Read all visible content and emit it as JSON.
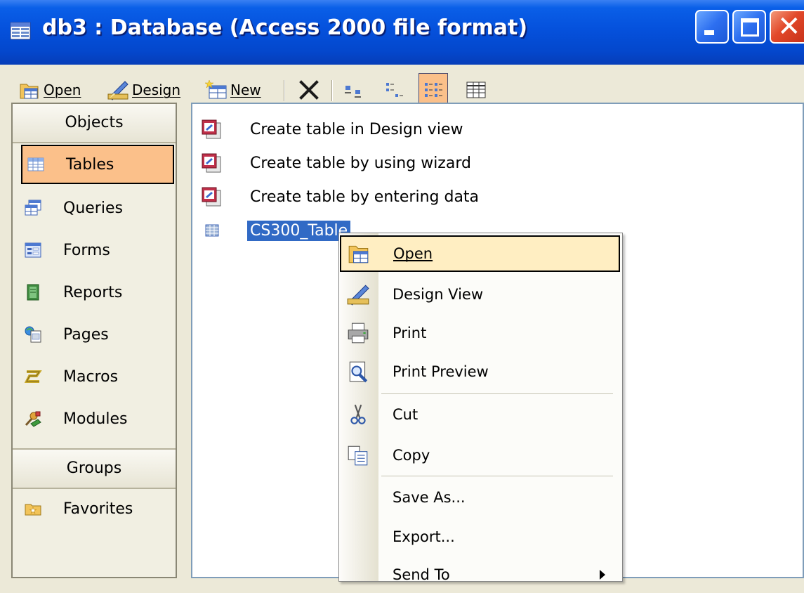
{
  "window": {
    "title": "db3 : Database (Access 2000 file format)"
  },
  "toolbar": {
    "open_label": "Open",
    "design_label": "Design",
    "new_label": "New"
  },
  "objects": {
    "header": "Objects",
    "items": [
      {
        "label": "Tables",
        "icon": "table-icon"
      },
      {
        "label": "Queries",
        "icon": "query-icon"
      },
      {
        "label": "Forms",
        "icon": "form-icon"
      },
      {
        "label": "Reports",
        "icon": "report-icon"
      },
      {
        "label": "Pages",
        "icon": "page-icon"
      },
      {
        "label": "Macros",
        "icon": "macro-icon"
      },
      {
        "label": "Modules",
        "icon": "module-icon"
      }
    ],
    "selected": "Tables"
  },
  "groups": {
    "header": "Groups",
    "items": [
      {
        "label": "Favorites",
        "icon": "favorites-folder-icon"
      }
    ]
  },
  "list": {
    "items": [
      {
        "label": "Create table in Design view"
      },
      {
        "label": "Create table by using wizard"
      },
      {
        "label": "Create table by entering data"
      },
      {
        "label": "CS300_Table"
      }
    ],
    "selected": "CS300_Table"
  },
  "context_menu": {
    "items": [
      {
        "label": "Open"
      },
      {
        "label": "Design View"
      },
      {
        "label": "Print"
      },
      {
        "label": "Print Preview"
      },
      {
        "label": "Cut"
      },
      {
        "label": "Copy"
      },
      {
        "label": "Save As..."
      },
      {
        "label": "Export..."
      },
      {
        "label": "Send To"
      }
    ],
    "highlighted": "Open"
  },
  "colors": {
    "titlebar": "#0551dc",
    "selected_object": "#fbc08a",
    "menu_highlight": "#ffeec2",
    "list_selection": "#316ac5"
  }
}
